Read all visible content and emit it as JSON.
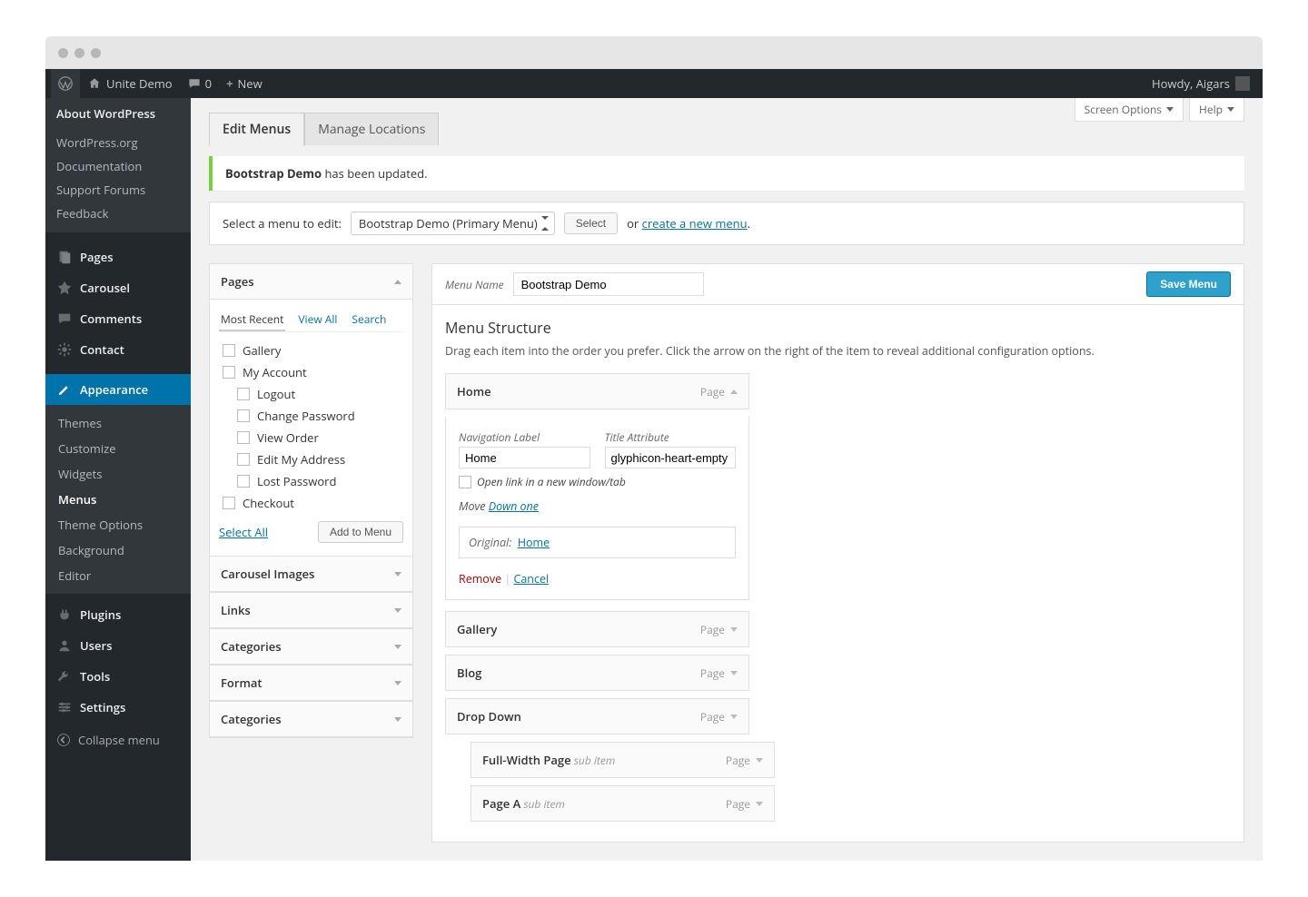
{
  "adminbar": {
    "site_name": "Unite Demo",
    "comments": "0",
    "new_label": "New",
    "howdy": "Howdy, Aigars"
  },
  "sidebar": {
    "about": "About WordPress",
    "links": [
      "WordPress.org",
      "Documentation",
      "Support Forums",
      "Feedback"
    ],
    "menu": [
      {
        "label": "Pages",
        "icon": "pages"
      },
      {
        "label": "Carousel",
        "icon": "pin"
      },
      {
        "label": "Comments",
        "icon": "comment"
      },
      {
        "label": "Contact",
        "icon": "gear"
      }
    ],
    "appearance": {
      "label": "Appearance",
      "subs": [
        "Themes",
        "Customize",
        "Widgets",
        "Menus",
        "Theme Options",
        "Background",
        "Editor"
      ],
      "current": "Menus"
    },
    "menu2": [
      {
        "label": "Plugins",
        "icon": "plug"
      },
      {
        "label": "Users",
        "icon": "user"
      },
      {
        "label": "Tools",
        "icon": "wrench"
      },
      {
        "label": "Settings",
        "icon": "sliders"
      }
    ],
    "collapse": "Collapse menu"
  },
  "screen": {
    "options": "Screen Options",
    "help": "Help"
  },
  "tabs": {
    "edit": "Edit Menus",
    "locations": "Manage Locations"
  },
  "notice": {
    "bold": "Bootstrap Demo",
    "rest": " has been updated."
  },
  "selectbar": {
    "label": "Select a menu to edit:",
    "selected": "Bootstrap Demo (Primary Menu)",
    "select_btn": "Select",
    "or": "or",
    "create": "create a new menu",
    "period": "."
  },
  "accordion": {
    "pages": {
      "title": "Pages",
      "filters": [
        "Most Recent",
        "View All",
        "Search"
      ],
      "items": [
        {
          "label": "Gallery",
          "indent": false
        },
        {
          "label": "My Account",
          "indent": false
        },
        {
          "label": "Logout",
          "indent": true
        },
        {
          "label": "Change Password",
          "indent": true
        },
        {
          "label": "View Order",
          "indent": true
        },
        {
          "label": "Edit My Address",
          "indent": true
        },
        {
          "label": "Lost Password",
          "indent": true
        },
        {
          "label": "Checkout",
          "indent": false
        }
      ],
      "select_all": "Select All",
      "add": "Add to Menu"
    },
    "others": [
      "Carousel Images",
      "Links",
      "Categories",
      "Format",
      "Categories"
    ]
  },
  "menuform": {
    "name_label": "Menu Name",
    "name_value": "Bootstrap Demo",
    "save": "Save Menu",
    "structure_heading": "Menu Structure",
    "help": "Drag each item into the order you prefer. Click the arrow on the right of the item to reveal additional configuration options."
  },
  "expanded": {
    "title": "Home",
    "type": "Page",
    "nav_label_lbl": "Navigation Label",
    "nav_label_val": "Home",
    "title_attr_lbl": "Title Attribute",
    "title_attr_val": "glyphicon-heart-empty",
    "open_new": "Open link in a new window/tab",
    "move": "Move",
    "down_one": "Down one",
    "original": "Original:",
    "orig_link": "Home",
    "remove": "Remove",
    "cancel": "Cancel"
  },
  "items": [
    {
      "label": "Gallery",
      "type": "Page",
      "sub": false
    },
    {
      "label": "Blog",
      "type": "Page",
      "sub": false
    },
    {
      "label": "Drop Down",
      "type": "Page",
      "sub": false
    },
    {
      "label": "Full-Width Page",
      "type": "Page",
      "sub": true,
      "subnote": "sub item"
    },
    {
      "label": "Page A",
      "type": "Page",
      "sub": true,
      "subnote": "sub item"
    }
  ]
}
